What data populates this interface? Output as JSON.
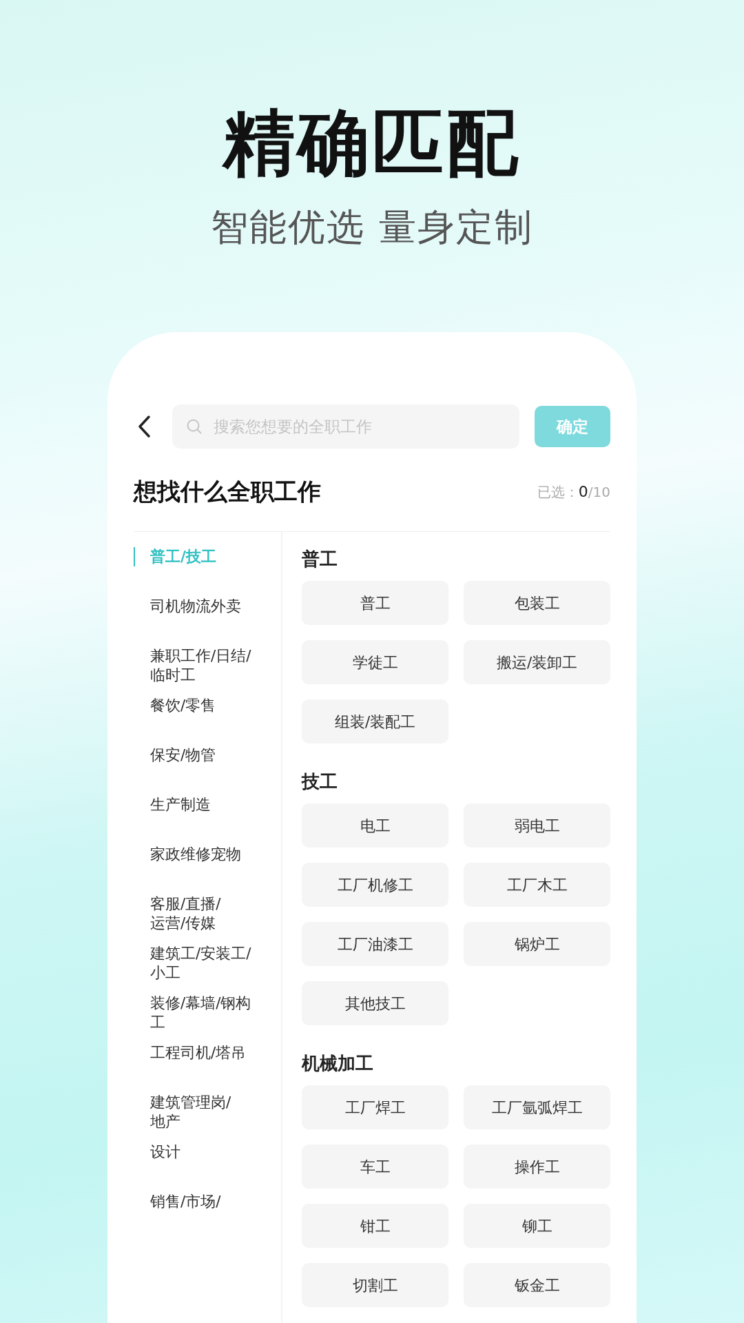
{
  "headline": "精确匹配",
  "subheadline": "智能优选 量身定制",
  "search": {
    "placeholder": "搜索您想要的全职工作"
  },
  "confirm_button": "确定",
  "page_title": "想找什么全职工作",
  "selection_count": {
    "label": "已选：",
    "selected": "0",
    "total": "/10"
  },
  "categories": [
    {
      "lines": [
        "普工/技工"
      ],
      "selected": true
    },
    {
      "lines": [
        "司机物流外卖"
      ],
      "selected": false
    },
    {
      "lines": [
        "兼职工作/日结/",
        "临时工"
      ],
      "selected": false
    },
    {
      "lines": [
        "餐饮/零售"
      ],
      "selected": false
    },
    {
      "lines": [
        "保安/物管"
      ],
      "selected": false
    },
    {
      "lines": [
        "生产制造"
      ],
      "selected": false
    },
    {
      "lines": [
        "家政维修宠物"
      ],
      "selected": false
    },
    {
      "lines": [
        "客服/直播/",
        "运营/传媒"
      ],
      "selected": false
    },
    {
      "lines": [
        "建筑工/安装工/",
        "小工"
      ],
      "selected": false
    },
    {
      "lines": [
        "装修/幕墙/钢构",
        "工"
      ],
      "selected": false
    },
    {
      "lines": [
        "工程司机/塔吊"
      ],
      "selected": false
    },
    {
      "lines": [
        "建筑管理岗/",
        "地产"
      ],
      "selected": false
    },
    {
      "lines": [
        "设计"
      ],
      "selected": false
    },
    {
      "lines": [
        "销售/市场/"
      ],
      "selected": false
    }
  ],
  "groups": [
    {
      "title": "普工",
      "jobs": [
        "普工",
        "包装工",
        "学徒工",
        "搬运/装卸工",
        "组装/装配工"
      ]
    },
    {
      "title": "技工",
      "jobs": [
        "电工",
        "弱电工",
        "工厂机修工",
        "工厂木工",
        "工厂油漆工",
        "锅炉工",
        "其他技工"
      ]
    },
    {
      "title": "机械加工",
      "jobs": [
        "工厂焊工",
        "工厂氩弧焊工",
        "车工",
        "操作工",
        "钳工",
        "铆工",
        "切割工",
        "钣金工"
      ]
    }
  ]
}
